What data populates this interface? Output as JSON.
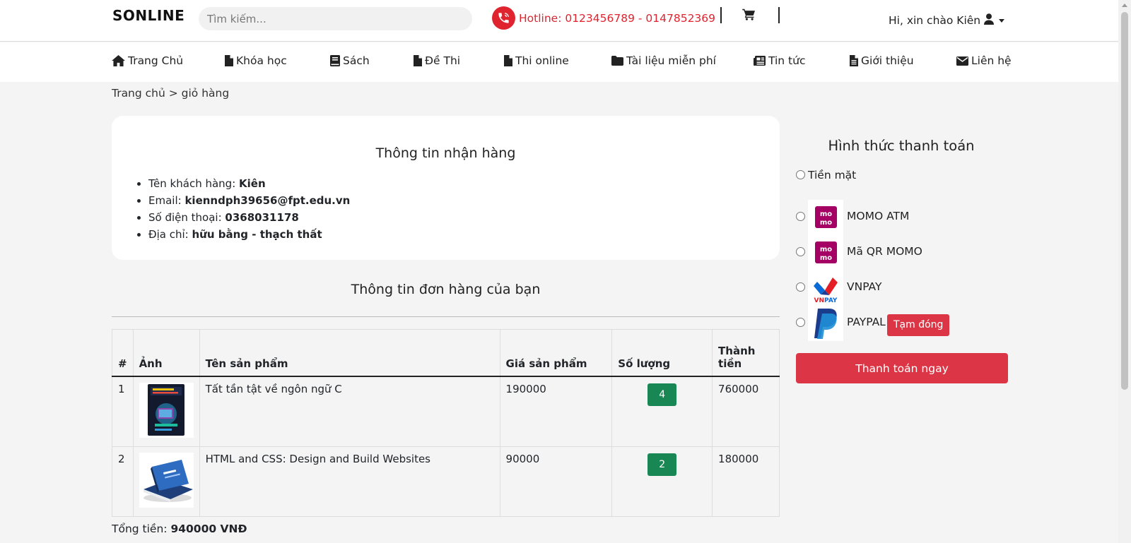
{
  "header": {
    "logo": "SONLINE",
    "search_placeholder": "Tìm kiếm...",
    "hotline": "Hotline: 0123456789 - 0147852369",
    "greeting": "Hi, xin chào Kiên"
  },
  "nav": [
    {
      "label": "Trang Chủ",
      "icon": "home-icon"
    },
    {
      "label": "Khóa học",
      "icon": "file-icon"
    },
    {
      "label": "Sách",
      "icon": "book-icon"
    },
    {
      "label": "Đề Thi",
      "icon": "file-icon"
    },
    {
      "label": "Thi online",
      "icon": "file-icon"
    },
    {
      "label": "Tài liệu miễn phí",
      "icon": "folder-icon"
    },
    {
      "label": "Tin tức",
      "icon": "newspaper-icon"
    },
    {
      "label": "Giới thiệu",
      "icon": "file-text-icon"
    },
    {
      "label": "Liên hệ",
      "icon": "envelope-icon"
    }
  ],
  "breadcrumb": "Trang chủ > giỏ hàng",
  "receiver": {
    "title": "Thông tin nhận hàng",
    "items": [
      {
        "label": "Tên khách hàng: ",
        "value": "Kiên"
      },
      {
        "label": "Email: ",
        "value": "kienndph39656@fpt.edu.vn"
      },
      {
        "label": "Số điện thoại: ",
        "value": "0368031178"
      },
      {
        "label": "Địa chỉ: ",
        "value": "hữu bằng - thạch thất"
      }
    ]
  },
  "order": {
    "title": "Thông tin đơn hàng của bạn",
    "columns": [
      "#",
      "Ảnh",
      "Tên sản phẩm",
      "Giá sản phẩm",
      "Số lượng",
      "Thành tiền"
    ],
    "rows": [
      {
        "index": "1",
        "name": "Tất tần tật về ngôn ngữ C",
        "price": "190000",
        "qty": "4",
        "total": "760000"
      },
      {
        "index": "2",
        "name": "HTML and CSS: Design and Build Websites",
        "price": "90000",
        "qty": "2",
        "total": "180000"
      }
    ],
    "total_label": "Tổng tiền: ",
    "total_value": "940000 VNĐ"
  },
  "payment": {
    "title": "Hình thức thanh toán",
    "options": [
      {
        "label": "Tiền mặt"
      },
      {
        "label": "MOMO ATM",
        "logo": "momo-logo"
      },
      {
        "label": "Mã QR MOMO",
        "logo": "momo-logo"
      },
      {
        "label": "VNPAY",
        "logo": "vnpay-logo"
      },
      {
        "label": "PAYPAL",
        "logo": "paypal-logo",
        "badge": "Tạm đóng"
      }
    ],
    "submit": "Thanh toán ngay"
  },
  "colors": {
    "danger": "#dc3545",
    "success": "#198754",
    "hotline": "#e0242f",
    "momo": "#a50064"
  }
}
